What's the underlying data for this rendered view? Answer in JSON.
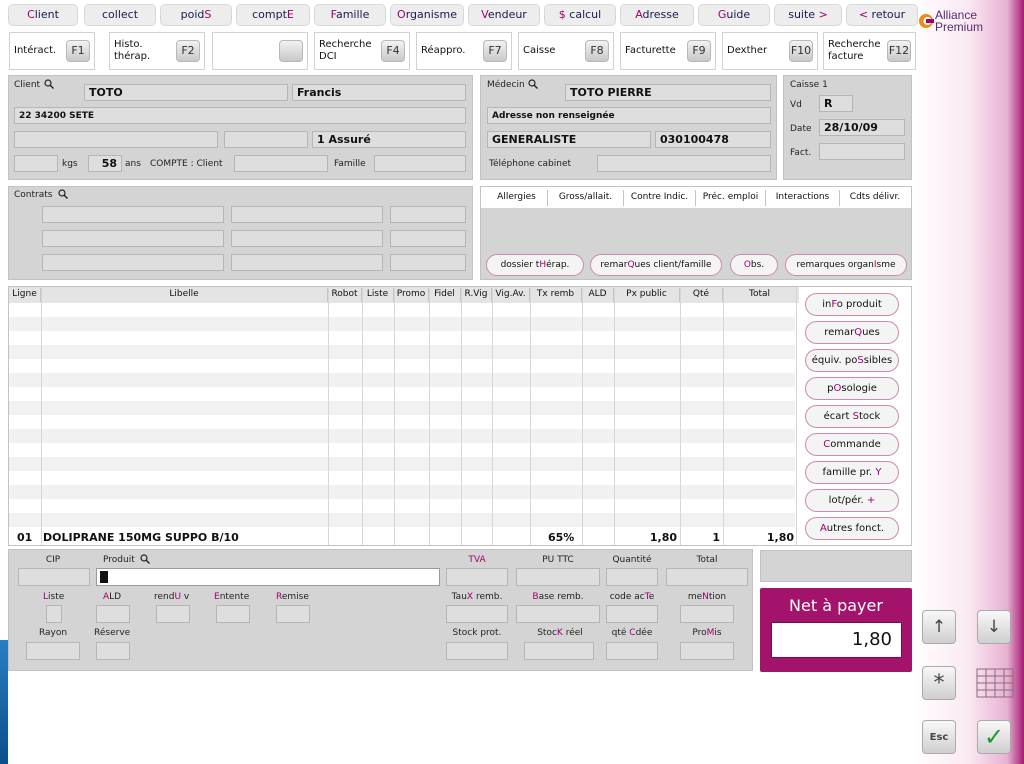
{
  "nav": {
    "client": "Client",
    "collect": "collect",
    "poids": "poidS",
    "compte": "comptE",
    "famille": "Famille",
    "organisme": "Organisme",
    "vendeur": "Vendeur",
    "calcul": "$ calcul",
    "adresse": "Adresse",
    "guide": "Guide",
    "suite": "suite >",
    "retour": "< retour"
  },
  "logo": {
    "line1": "Alliance",
    "line2": "Premium"
  },
  "fkeys": [
    {
      "label": "Intéract.",
      "key": "F1"
    },
    {
      "label": "Histo. thérap.",
      "key": "F2"
    },
    {
      "label": "",
      "key": ""
    },
    {
      "label": "Recherche DCI",
      "key": "F4"
    },
    {
      "label": "Réappro.",
      "key": "F7"
    },
    {
      "label": "Caisse",
      "key": "F8"
    },
    {
      "label": "Facturette",
      "key": "F9"
    },
    {
      "label": "Dexther",
      "key": "F10"
    },
    {
      "label": "Recherche facture",
      "key": "F12"
    }
  ],
  "client": {
    "label": "Client",
    "nom": "TOTO",
    "prenom": "Francis",
    "adresse": "22 34200 SETE",
    "assure": "1 Assuré",
    "kgs_label": "kgs",
    "age": "58",
    "ans_label": "ans",
    "compte_label": "COMPTE : Client",
    "famille_label": "Famille"
  },
  "medecin": {
    "label": "Médecin",
    "nom": "TOTO PIERRE",
    "adresse": "Adresse non renseignée",
    "specialite": "GENERALISTE",
    "code": "030100478",
    "tel_label": "Téléphone cabinet"
  },
  "caisse": {
    "label": "Caisse 1",
    "vd_label": "Vd",
    "vd": "R",
    "date_label": "Date",
    "date": "28/10/09",
    "fact_label": "Fact."
  },
  "contrats": {
    "label": "Contrats"
  },
  "tabs": [
    "Allergies",
    "Gross/allait.",
    "Contre Indic.",
    "Préc. emploi",
    "Interactions",
    "Cdts délivr."
  ],
  "pills": {
    "dossier": "dossier tHérap.",
    "remarques": "remarQues client/famille",
    "obs": "Obs.",
    "organisme": "remarques organIsme"
  },
  "table": {
    "headers": [
      "Ligne",
      "Libelle",
      "Robot",
      "Liste",
      "Promo",
      "Fidel",
      "R.Vig",
      "Vig.Av.",
      "Tx remb",
      "ALD",
      "Px public",
      "Qté",
      "Total"
    ],
    "rows": [
      {
        "ligne": "01",
        "libelle": "DOLIPRANE 150MG SUPPO B/10",
        "tx_remb": "65%",
        "px_public": "1,80",
        "qte": "1",
        "total": "1,80"
      }
    ]
  },
  "side_buttons": {
    "info": "inFo produit",
    "remarques": "remarQues",
    "equiv": "équiv. poSsibles",
    "posologie": "pOsologie",
    "ecart": "écart Stock",
    "commande": "Commande",
    "famille": "famille pr. Y",
    "lot": "lot/pér. +",
    "autres": "Autres fonct."
  },
  "entry": {
    "cip": "CIP",
    "produit": "Produit",
    "tva": "TVA",
    "pu_ttc": "PU TTC",
    "quantite": "Quantité",
    "total": "Total",
    "liste": "Liste",
    "ald": "ALD",
    "rendu": "renduU v",
    "entente": "Entente",
    "remise": "Remise",
    "taux": "TauX remb.",
    "base": "Base remb.",
    "code_acte": "code acTe",
    "mention": "meNtion",
    "rayon": "Rayon",
    "reserve": "Réserve",
    "stock_prot": "Stock prot.",
    "stock_reel": "StocK réel",
    "qte_cdee": "qté Cdée",
    "promis": "ProMis"
  },
  "net": {
    "label": "Net à payer",
    "value": "1,80"
  },
  "keys": {
    "up": "↑",
    "down": "↓",
    "star": "*",
    "esc": "Esc",
    "ok": "✓"
  },
  "colors": {
    "accent": "#a0006e",
    "panel": "#d4d4d4",
    "ok_green": "#1e9b2e"
  }
}
